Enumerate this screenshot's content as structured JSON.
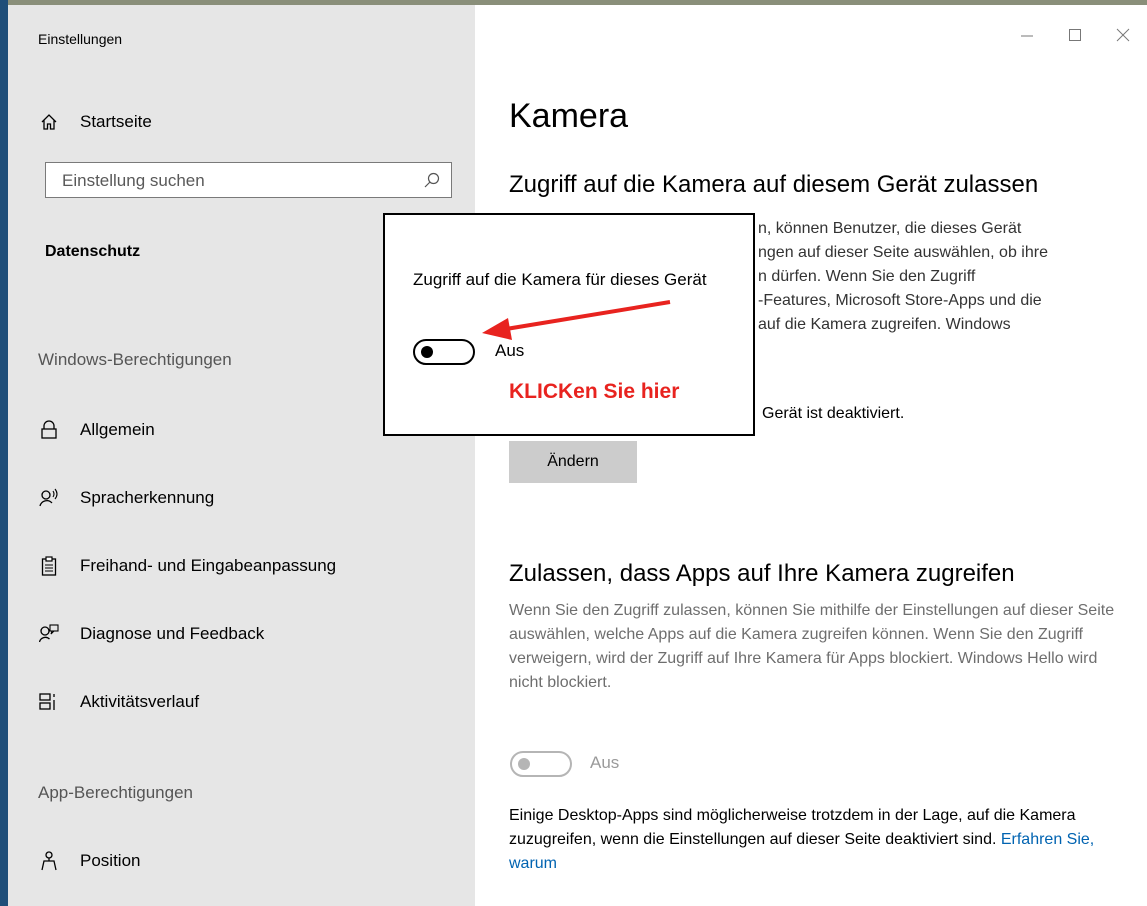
{
  "window": {
    "title": "Einstellungen",
    "controls": {
      "minimize": "—",
      "maximize": "☐",
      "close": "✕"
    }
  },
  "sidebar": {
    "home": "Startseite",
    "search_placeholder": "Einstellung suchen",
    "category": "Datenschutz",
    "windows_section": "Windows-Berechtigungen",
    "windows_items": [
      {
        "label": "Allgemein",
        "icon": "lock-icon"
      },
      {
        "label": "Spracherkennung",
        "icon": "speech-icon"
      },
      {
        "label": "Freihand- und Eingabeanpassung",
        "icon": "clipboard-icon"
      },
      {
        "label": "Diagnose und Feedback",
        "icon": "feedback-icon"
      },
      {
        "label": "Aktivitätsverlauf",
        "icon": "timeline-icon"
      }
    ],
    "app_section": "App-Berechtigungen",
    "app_items": [
      {
        "label": "Position",
        "icon": "location-person-icon"
      }
    ]
  },
  "main": {
    "title": "Kamera",
    "section1": {
      "heading": "Zugriff auf die Kamera auf diesem Gerät zulassen",
      "lines": [
        "n, können Benutzer, die dieses Gerät",
        "ngen auf dieser Seite auswählen, ob ihre",
        "n dürfen. Wenn Sie den Zugriff",
        "-Features, Microsoft Store-Apps und die",
        "auf die Kamera zugreifen. Windows"
      ],
      "status": "Gerät ist deaktiviert.",
      "button": "Ändern"
    },
    "section2": {
      "heading": "Zulassen, dass Apps auf Ihre Kamera zugreifen",
      "description": "Wenn Sie den Zugriff zulassen, können Sie mithilfe der Einstellungen auf dieser Seite auswählen, welche Apps auf die Kamera zugreifen können. Wenn Sie den Zugriff verweigern, wird der Zugriff auf Ihre Kamera für Apps blockiert. Windows Hello wird nicht blockiert.",
      "toggle_label": "Aus",
      "toggle_on": false,
      "note": "Einige Desktop-Apps sind möglicherweise trotzdem in der Lage, auf die Kamera zuzugreifen, wenn die Einstellungen auf dieser Seite deaktiviert sind.",
      "link": "Erfahren Sie, warum"
    }
  },
  "popup": {
    "label": "Zugriff auf die Kamera für dieses Gerät",
    "toggle_label": "Aus",
    "toggle_on": false,
    "cta": "KLICKen Sie hier",
    "cta_color": "#e8231f"
  },
  "colors": {
    "sidebar_bg": "#e6e6e6",
    "accent": "#0063b1",
    "annotation": "#e8231f"
  }
}
